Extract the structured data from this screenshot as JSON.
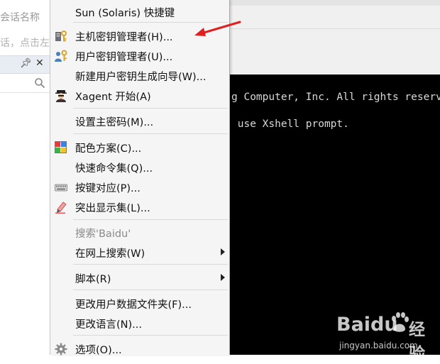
{
  "left_panel": {
    "session_name_label": "会话名称",
    "session_hint_label": "话，点击左",
    "pin_icon": "pin-icon",
    "close_icon": "close-icon",
    "search_icon": "search-icon"
  },
  "terminal": {
    "lines": [
      "g Computer, Inc. All rights reserv",
      " use Xshell prompt."
    ]
  },
  "menu": {
    "items": [
      {
        "label": "Sun (Solaris) 快捷键",
        "icon": ""
      },
      {
        "label": "主机密钥管理者(H)...",
        "icon": "host-key-icon"
      },
      {
        "label": "用户密钥管理者(U)...",
        "icon": "user-key-icon"
      },
      {
        "label": "新建用户密钥生成向导(W)...",
        "icon": ""
      },
      {
        "label": "Xagent 开始(A)",
        "icon": "xagent-icon"
      },
      {
        "label": "设置主密码(M)...",
        "icon": ""
      },
      {
        "label": "配色方案(C)...",
        "icon": "color-scheme-icon"
      },
      {
        "label": "快速命令集(Q)...",
        "icon": ""
      },
      {
        "label": "按键对应(P)...",
        "icon": "keyboard-icon"
      },
      {
        "label": "突出显示集(L)...",
        "icon": "highlight-icon"
      },
      {
        "label": "搜索'Baidu'",
        "icon": ""
      },
      {
        "label": "在网上搜索(W)",
        "icon": ""
      },
      {
        "label": "脚本(R)",
        "icon": ""
      },
      {
        "label": "更改用户数据文件夹(F)...",
        "icon": ""
      },
      {
        "label": "更改语言(N)...",
        "icon": ""
      },
      {
        "label": "选项(O)...",
        "icon": "gear-icon"
      }
    ]
  },
  "watermark": {
    "brand": "Baidu",
    "brand_suffix": "经验",
    "url": "jingyan.baidu.com"
  },
  "colors": {
    "terminal_bg": "#000000",
    "menu_bg": "#f5f5f5",
    "annotation_red": "#e02020"
  }
}
